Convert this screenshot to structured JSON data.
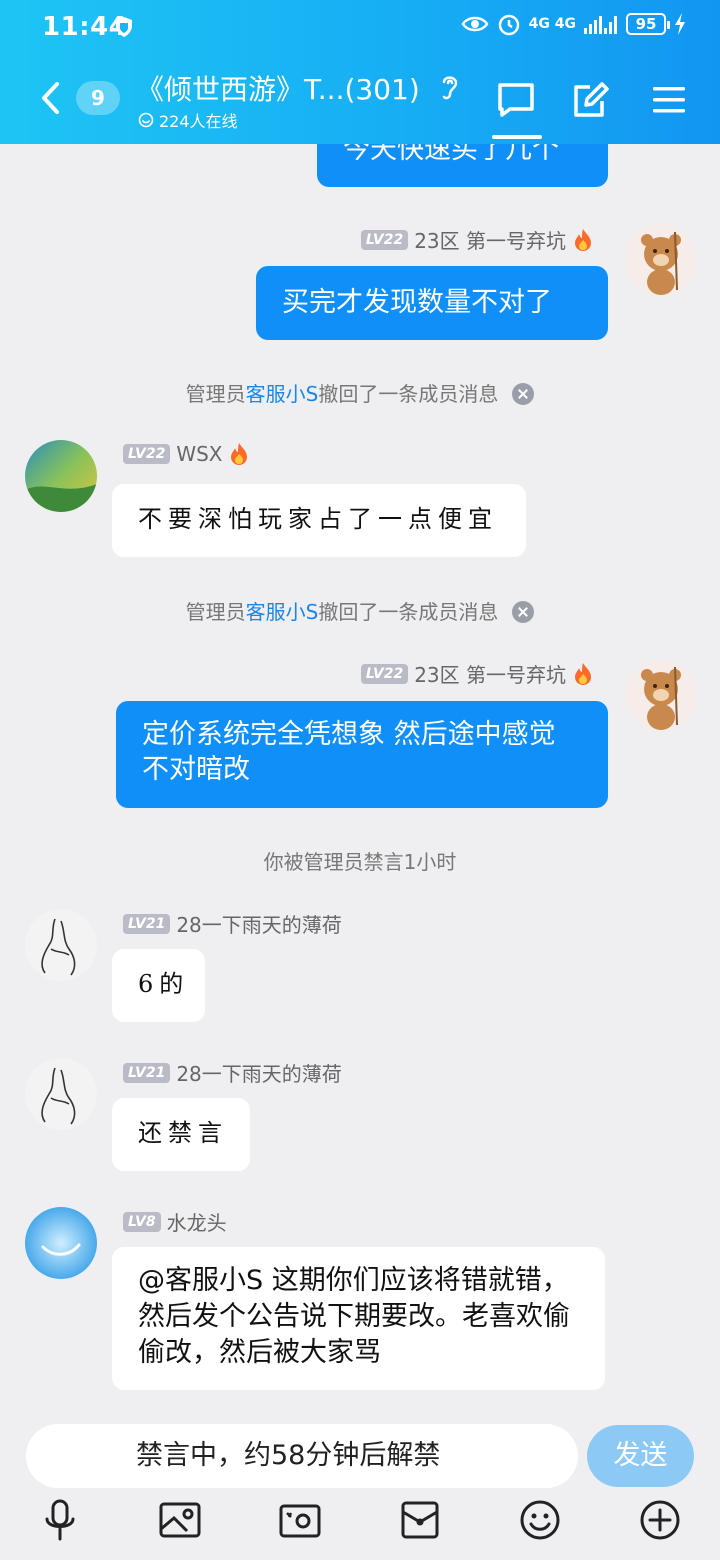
{
  "status_bar": {
    "time": "11:44",
    "network": "4G 4G",
    "battery": "95"
  },
  "header": {
    "unread_count": "9",
    "title": "《倾世西游》T...(301)",
    "online_text": "224人在线"
  },
  "messages": [
    {
      "type": "self",
      "text": "今天快速买了几个"
    },
    {
      "type": "self",
      "level": "LV22",
      "sender": "23区 第一号弃坑",
      "text": "买完才发现数量不对了"
    },
    {
      "type": "system",
      "prefix": "管理员",
      "name": "客服小S",
      "suffix": "撤回了一条成员消息"
    },
    {
      "type": "other",
      "level": "LV22",
      "sender": "WSX",
      "text": "不要深怕玩家占了一点便宜"
    },
    {
      "type": "system",
      "prefix": "管理员",
      "name": "客服小S",
      "suffix": "撤回了一条成员消息"
    },
    {
      "type": "self",
      "level": "LV22",
      "sender": "23区 第一号弃坑",
      "text": "定价系统完全凭想象 然后途中感觉不对暗改"
    },
    {
      "type": "system",
      "text": "你被管理员禁言1小时"
    },
    {
      "type": "other",
      "level": "LV21",
      "sender": "28一下雨天的薄荷",
      "text": "6的"
    },
    {
      "type": "other",
      "level": "LV21",
      "sender": "28一下雨天的薄荷",
      "text": "还禁言"
    },
    {
      "type": "other",
      "level": "LV8",
      "sender": "水龙头",
      "text": "@客服小S 这期你们应该将错就错，然后发个公告说下期要改。老喜欢偷偷改，然后被大家骂"
    }
  ],
  "input": {
    "muted_text": "禁言中，约58分钟后解禁",
    "send_label": "发送"
  },
  "icons": [
    "back-icon",
    "chat-bubble-icon",
    "edit-icon",
    "menu-icon",
    "mic-icon",
    "image-icon",
    "camera-icon",
    "red-packet-icon",
    "emoji-icon",
    "plus-icon"
  ],
  "colors": {
    "header_start": "#1ec5f4",
    "header_end": "#1296f2",
    "self_bubble": "#0f8ff7",
    "send_button": "#8dc9f5",
    "link": "#1a86e8"
  }
}
